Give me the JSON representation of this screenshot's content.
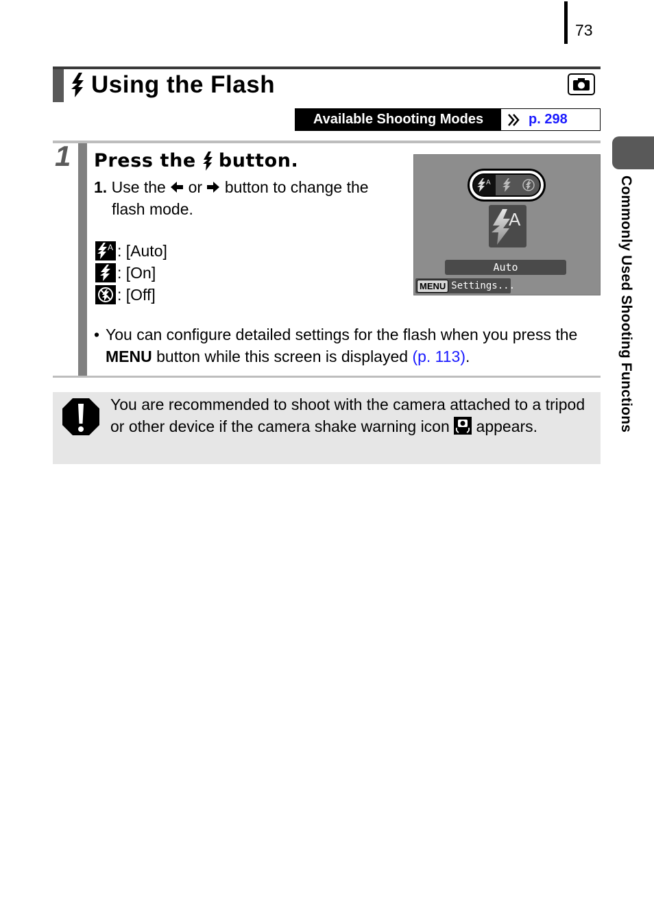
{
  "page": {
    "number": "73",
    "side_tab_label": "Commonly Used Shooting Functions"
  },
  "header": {
    "title_icon": "flash-icon",
    "title": "Using the Flash",
    "mode_icon": "camera-icon",
    "available_modes_label": "Available Shooting Modes",
    "available_modes_link": "p. 298"
  },
  "step": {
    "number": "1",
    "heading_before": "Press the",
    "heading_icon": "flash-icon",
    "heading_after": "button.",
    "instruction": {
      "index": "1.",
      "text_before": "Use the",
      "left_icon": "arrow-left-icon",
      "text_middle": "or",
      "right_icon": "arrow-right-icon",
      "text_after": "button to change the",
      "text_line2": "flash mode."
    },
    "modes": [
      {
        "icon": "flash-auto-icon",
        "label": ": [Auto]"
      },
      {
        "icon": "flash-on-icon",
        "label": ": [On]"
      },
      {
        "icon": "flash-off-icon",
        "label": ": [Off]"
      }
    ],
    "screen": {
      "options": [
        "flash-auto",
        "flash-on",
        "flash-off"
      ],
      "selected": "flash-auto",
      "mode_name": "Auto",
      "menu_key": "MENU",
      "settings_label": "Settings..."
    },
    "note": {
      "bullet": "•",
      "text_before": "You can configure detailed settings for the flash when you press the",
      "bold": "MENU",
      "text_after": "button while this screen is displayed",
      "link": "(p. 113)",
      "end": "."
    }
  },
  "caution": {
    "icon": "caution-icon",
    "text_before": "You are recommended to shoot with the camera attached to a tripod or other device if the camera shake warning icon",
    "inline_icon": "camera-shake-icon",
    "text_after": "appears."
  },
  "colors": {
    "link": "#1a1aff",
    "tab_gray": "#595959",
    "step_bar": "#808080",
    "caution_bg": "#e6e6e6"
  }
}
